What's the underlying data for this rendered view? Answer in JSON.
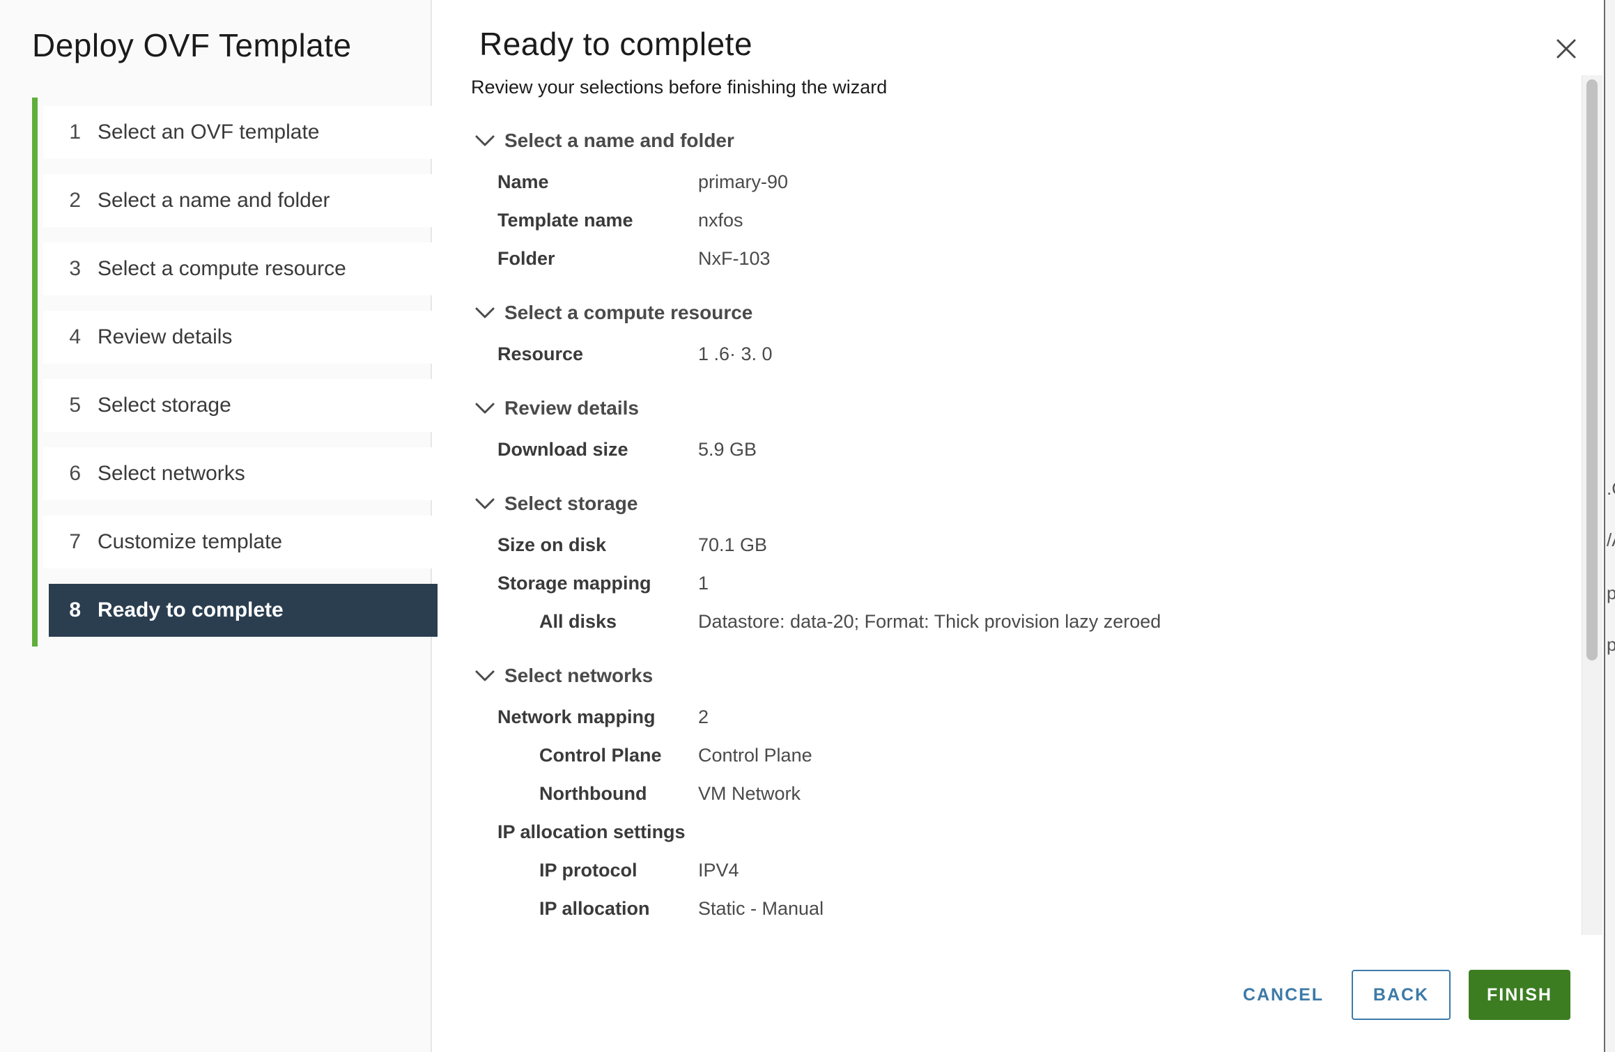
{
  "wizard": {
    "title": "Deploy OVF Template",
    "steps": [
      {
        "num": "1",
        "label": "Select an OVF template"
      },
      {
        "num": "2",
        "label": "Select a name and folder"
      },
      {
        "num": "3",
        "label": "Select a compute resource"
      },
      {
        "num": "4",
        "label": "Review details"
      },
      {
        "num": "5",
        "label": "Select storage"
      },
      {
        "num": "6",
        "label": "Select networks"
      },
      {
        "num": "7",
        "label": "Customize template"
      },
      {
        "num": "8",
        "label": "Ready to complete"
      }
    ],
    "active_step": 8
  },
  "main": {
    "title": "Ready to complete",
    "subtitle": "Review your selections before finishing the wizard",
    "sections": [
      {
        "heading": "Select a name and folder",
        "rows": [
          {
            "key": "Name",
            "value": "primary-90"
          },
          {
            "key": "Template name",
            "value": "nxfos"
          },
          {
            "key": "Folder",
            "value": "NxF-103"
          }
        ]
      },
      {
        "heading": "Select a compute resource",
        "rows": [
          {
            "key": "Resource",
            "value": "1 .6· 3. 0"
          }
        ]
      },
      {
        "heading": "Review details",
        "rows": [
          {
            "key": "Download size",
            "value": "5.9 GB"
          }
        ]
      },
      {
        "heading": "Select storage",
        "rows": [
          {
            "key": "Size on disk",
            "value": "70.1 GB"
          },
          {
            "key": "Storage mapping",
            "value": "1"
          },
          {
            "key": "All disks",
            "value": "Datastore: data-20; Format: Thick provision lazy zeroed",
            "indent": true
          }
        ]
      },
      {
        "heading": "Select networks",
        "rows": [
          {
            "key": "Network mapping",
            "value": "2"
          },
          {
            "key": "Control Plane",
            "value": "Control Plane",
            "indent": true
          },
          {
            "key": "Northbound",
            "value": "VM Network",
            "indent": true
          },
          {
            "key": "IP allocation settings",
            "value": ""
          },
          {
            "key": "IP protocol",
            "value": "IPV4",
            "indent": true
          },
          {
            "key": "IP allocation",
            "value": "Static - Manual",
            "indent": true
          }
        ]
      }
    ]
  },
  "footer": {
    "cancel_label": "CANCEL",
    "back_label": "BACK",
    "finish_label": "FINISH"
  },
  "backdrop": {
    "fragments": [
      ".C",
      "/A",
      "p",
      "p"
    ]
  },
  "icons": {
    "close": "close-icon",
    "chevron": "chevron-down-icon"
  },
  "colors": {
    "accent_green": "#5fae3c",
    "active_step_bg": "#2b3e50",
    "primary_button": "#3c7d22",
    "link_blue": "#3d7aa8"
  }
}
